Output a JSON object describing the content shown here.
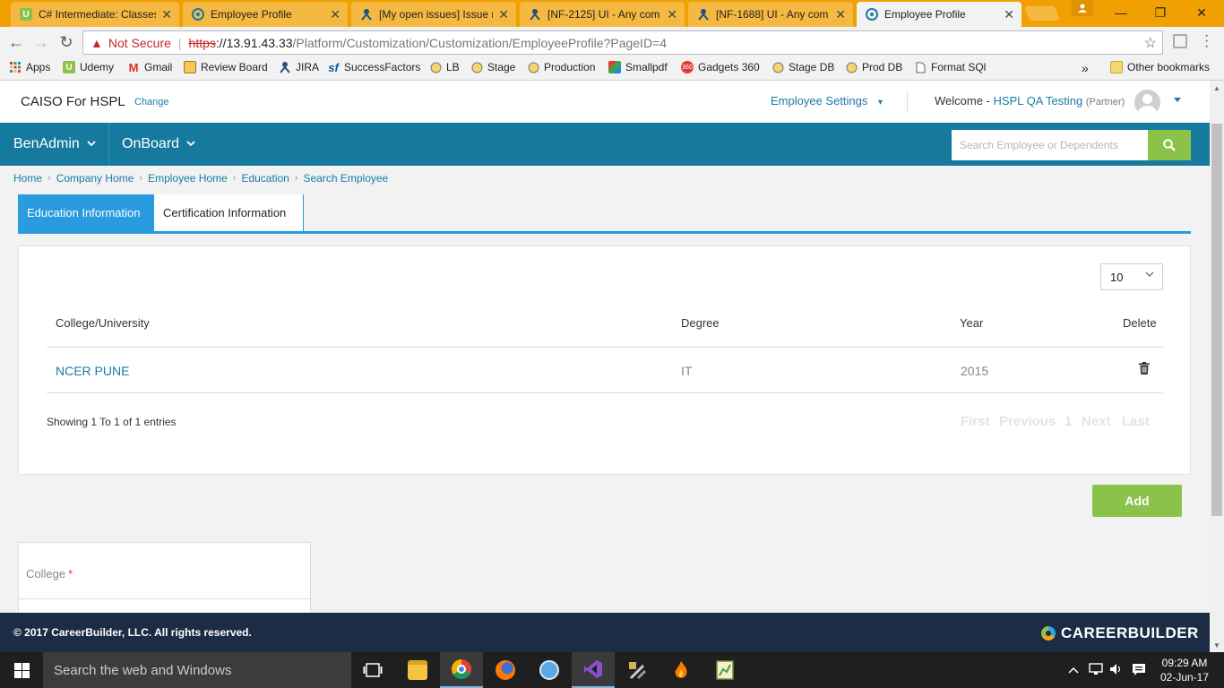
{
  "browser": {
    "tabs": [
      {
        "title": "C# Intermediate: Classes",
        "favicon": "udemy-icon",
        "color": "#8bc34a",
        "letter": "U"
      },
      {
        "title": "Employee Profile",
        "favicon": "page-globe-icon",
        "color": "#1a7aa8",
        "letter": ""
      },
      {
        "title": "[My open issues] Issue n",
        "favicon": "jira-icon",
        "color": "#205081",
        "letter": ""
      },
      {
        "title": "[NF-2125] UI - Any com",
        "favicon": "jira-icon",
        "color": "#205081",
        "letter": ""
      },
      {
        "title": "[NF-1688] UI - Any com",
        "favicon": "jira-icon",
        "color": "#205081",
        "letter": ""
      },
      {
        "title": "Employee Profile",
        "favicon": "page-globe-icon",
        "color": "#1a7aa8",
        "letter": ""
      }
    ],
    "window_controls": {
      "minimize": "—",
      "restore": "❐",
      "close": "✕"
    },
    "address": {
      "security_text": "Not Secure",
      "scheme": "https",
      "host": "://13.91.43.33",
      "path": "/Platform/Customization/Customization/EmployeeProfile?PageID=4"
    },
    "bookmarks": [
      {
        "label": "Apps",
        "icon": "apps-grid-icon"
      },
      {
        "label": "Udemy",
        "icon": "udemy-icon"
      },
      {
        "label": "Gmail",
        "icon": "gmail-icon"
      },
      {
        "label": "Review Board",
        "icon": "review-board-icon"
      },
      {
        "label": "JIRA",
        "icon": "jira-icon"
      },
      {
        "label": "SuccessFactors",
        "icon": "successfactors-icon"
      },
      {
        "label": "LB",
        "icon": "globe-icon"
      },
      {
        "label": "Stage",
        "icon": "globe-icon"
      },
      {
        "label": "Production",
        "icon": "globe-icon"
      },
      {
        "label": "Smallpdf",
        "icon": "smallpdf-icon"
      },
      {
        "label": "Gadgets 360",
        "icon": "gadgets360-icon"
      },
      {
        "label": "Stage DB",
        "icon": "globe-icon"
      },
      {
        "label": "Prod DB",
        "icon": "globe-icon"
      },
      {
        "label": "Format SQl",
        "icon": "document-icon"
      }
    ],
    "bookmarks_overflow": "»",
    "other_bookmarks": "Other bookmarks"
  },
  "header": {
    "company": "CAISO For HSPL",
    "change_label": "Change",
    "settings_label": "Employee Settings",
    "welcome_label": "Welcome -",
    "user_name": "HSPL QA Testing",
    "user_role": "(Partner)"
  },
  "navbar": {
    "items": [
      {
        "label": "BenAdmin"
      },
      {
        "label": "OnBoard"
      }
    ],
    "search_placeholder": "Search Employee or Dependents"
  },
  "breadcrumb": [
    "Home",
    "Company Home",
    "Employee Home",
    "Education",
    "Search Employee"
  ],
  "page_tabs": {
    "active": "Education Information",
    "inactive": "Certification Information"
  },
  "table": {
    "page_size": "10",
    "columns": [
      "College/University",
      "Degree",
      "Year",
      "Delete"
    ],
    "rows": [
      {
        "college": "NCER PUNE",
        "degree": "IT",
        "year": "2015"
      }
    ],
    "showing": "Showing 1 To 1 of 1 entries",
    "pager": {
      "first": "First",
      "previous": "Previous",
      "current": "1",
      "next": "Next",
      "last": "Last"
    }
  },
  "add_label": "Add",
  "form": {
    "college_label": "College",
    "required_mark": "*"
  },
  "footer": {
    "copyright": "© 2017 CareerBuilder, LLC. All rights reserved.",
    "logo": "CAREERBUILDER"
  },
  "taskbar": {
    "search_placeholder": "Search the web and Windows",
    "time": "09:29 AM",
    "date": "02-Jun-17"
  },
  "colors": {
    "brand_teal": "#167a9e",
    "accent_blue": "#2b9be0",
    "green": "#8bc34a",
    "footer": "#1c2c45",
    "tab_strip": "#f0a000"
  }
}
